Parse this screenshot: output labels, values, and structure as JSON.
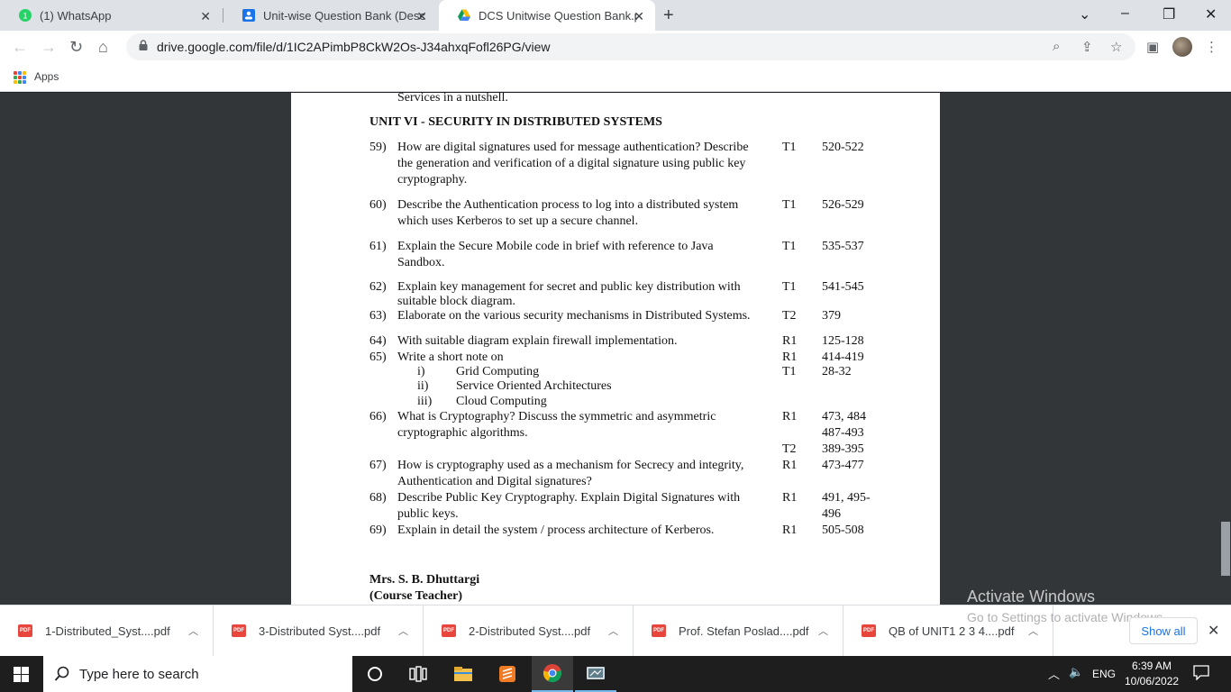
{
  "browser": {
    "tabs": [
      {
        "title": "(1) WhatsApp",
        "badge": "1"
      },
      {
        "title": "Unit-wise Question Bank (Descrip"
      },
      {
        "title": "DCS Unitwise Question Bank.pdf",
        "active": true
      }
    ],
    "url": "drive.google.com/file/d/1IC2APimbP8CkW2Os-J34ahxqFofl26PG/view",
    "bookmarks": {
      "apps_label": "Apps"
    }
  },
  "document": {
    "prev_line": "Services in a nutshell.",
    "unit_heading": "UNIT VI - SECURITY IN DISTRIBUTED SYSTEMS",
    "questions": [
      {
        "num": "59)",
        "lines": [
          "How are digital signatures used for message authentication? Describe",
          "the generation and verification of a digital signature using public key",
          "cryptography."
        ],
        "refs": [
          {
            "book": "T1",
            "pages": "520-522"
          }
        ]
      },
      {
        "num": "60)",
        "lines": [
          "Describe the Authentication process to log into a distributed system",
          "which uses Kerberos to set up a secure channel."
        ],
        "refs": [
          {
            "book": "T1",
            "pages": "526-529"
          }
        ]
      },
      {
        "num": "61)",
        "lines": [
          "Explain the Secure Mobile code in brief with reference to Java",
          "Sandbox."
        ],
        "refs": [
          {
            "book": "T1",
            "pages": "535-537"
          }
        ]
      },
      {
        "num": "62)",
        "lines": [
          "Explain key management for secret and public key distribution with",
          "suitable block diagram."
        ],
        "refs": [
          {
            "book": "T1",
            "pages": "541-545"
          }
        ]
      },
      {
        "num": "63)",
        "lines": [
          "Elaborate on the various security mechanisms in Distributed Systems."
        ],
        "refs": [
          {
            "book": "T2",
            "pages": "379"
          }
        ]
      },
      {
        "num": "64)",
        "lines": [
          "With suitable diagram explain firewall implementation."
        ],
        "refs": [
          {
            "book": "R1",
            "pages": "125-128"
          }
        ]
      },
      {
        "num": "65)",
        "lines": [
          "Write a short note on"
        ],
        "refs": [
          {
            "book": "R1",
            "pages": "414-419"
          },
          {
            "book": "T1",
            "pages": "28-32"
          }
        ],
        "subitems": [
          {
            "roman": "i)",
            "text": "Grid Computing"
          },
          {
            "roman": "ii)",
            "text": "Service Oriented Architectures"
          },
          {
            "roman": "iii)",
            "text": "Cloud Computing"
          }
        ]
      },
      {
        "num": "66)",
        "lines": [
          "What is Cryptography? Discuss the symmetric and asymmetric",
          "cryptographic algorithms."
        ],
        "refs": [
          {
            "book": "R1",
            "pages": "473, 484"
          },
          {
            "book": "",
            "pages": "487-493"
          },
          {
            "book": "T2",
            "pages": "389-395"
          }
        ]
      },
      {
        "num": "67)",
        "lines": [
          "How is cryptography used as a mechanism for Secrecy and integrity,",
          "Authentication and Digital signatures?"
        ],
        "refs": [
          {
            "book": "R1",
            "pages": "473-477"
          }
        ]
      },
      {
        "num": "68)",
        "lines": [
          "Describe Public Key Cryptography. Explain Digital Signatures with",
          "public keys."
        ],
        "refs": [
          {
            "book": "R1",
            "pages": "491, 495-"
          },
          {
            "book": "",
            "pages": "496"
          }
        ]
      },
      {
        "num": "69)",
        "lines": [
          "Explain in detail the system / process architecture of Kerberos."
        ],
        "refs": [
          {
            "book": "R1",
            "pages": "505-508"
          }
        ]
      }
    ],
    "teacher_name": "Mrs. S. B. Dhuttargi",
    "teacher_role": "(Course Teacher)"
  },
  "watermark": {
    "line1": "Activate Windows",
    "line2": "Go to Settings to activate Windows."
  },
  "downloads": {
    "items": [
      "1-Distributed_Syst....pdf",
      "3-Distributed Syst....pdf",
      "2-Distributed Syst....pdf",
      "Prof. Stefan Poslad....pdf",
      "QB of UNIT1 2 3 4....pdf"
    ],
    "show_all": "Show all",
    "file_badge": "PDF"
  },
  "taskbar": {
    "search_placeholder": "Type here to search",
    "lang": "ENG",
    "time": "6:39 AM",
    "date": "10/06/2022"
  },
  "colors": {
    "accent": "#1a73e8",
    "pdf_red": "#e8453c",
    "whatsapp": "#25d366"
  }
}
